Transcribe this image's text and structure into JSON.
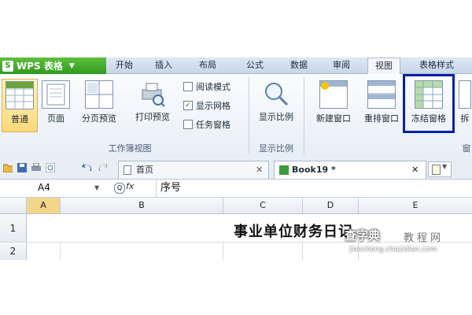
{
  "app": {
    "name": "WPS 表格",
    "logo_letter": "S"
  },
  "ribbon_tabs": [
    "开始",
    "插入",
    "布局",
    "公式",
    "数据",
    "审阅",
    "视图",
    "表格样式"
  ],
  "active_tab": "视图",
  "ribbon": {
    "btn_normal": "普通",
    "btn_page": "页面",
    "btn_pagebreak": "分页预览",
    "btn_print_preview": "打印预览",
    "chk_read_mode": "阅读模式",
    "chk_show_grid": "显示网格",
    "chk_task_pane": "任务窗格",
    "btn_zoom": "显示比例",
    "btn_new_window": "新建窗口",
    "btn_rearrange": "重排窗口",
    "btn_freeze": "冻结窗格",
    "btn_cut": "拆",
    "group_workbook_view": "工作簿视图",
    "group_zoom": "显示比例",
    "group_window_cut": "窗"
  },
  "checkboxes": {
    "read_mode": false,
    "show_grid": true,
    "task_pane": false
  },
  "doc_tabs": [
    {
      "label": "首页"
    },
    {
      "label": "Book19 *"
    }
  ],
  "formula_bar": {
    "cell_ref": "A4",
    "fx_label": "fx",
    "value": "序号"
  },
  "columns": [
    "A",
    "B",
    "C",
    "D",
    "E"
  ],
  "rows": [
    "1",
    "2"
  ],
  "sheet_title": "事业单位财务日记",
  "watermark": {
    "brand": "查字典",
    "site": "教程网",
    "url": "jiaocheng.chazidian.com"
  },
  "colors": {
    "app_green": "#2f9a1f",
    "highlight_box": "#0b1fa8",
    "selected_header": "#f4d68a"
  }
}
